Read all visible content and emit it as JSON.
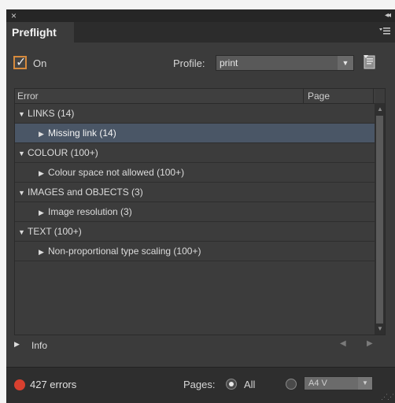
{
  "window": {
    "close_glyph": "×",
    "collapse_glyph": "◂◂"
  },
  "tab": {
    "title": "Preflight",
    "menu_icon": "panel-menu-icon"
  },
  "controls": {
    "on_checked": true,
    "on_label": "On",
    "profile_label": "Profile:",
    "profile_value": "print"
  },
  "list": {
    "columns": [
      "Error",
      "Page"
    ],
    "rows": [
      {
        "kind": "group",
        "expanded": true,
        "label": "LINKS (14)"
      },
      {
        "kind": "child",
        "expanded": false,
        "label": "Missing link (14)",
        "selected": true
      },
      {
        "kind": "group",
        "expanded": true,
        "label": "COLOUR (100+)"
      },
      {
        "kind": "child",
        "expanded": false,
        "label": "Colour space not allowed (100+)"
      },
      {
        "kind": "group",
        "expanded": true,
        "label": "IMAGES and OBJECTS (3)"
      },
      {
        "kind": "child",
        "expanded": false,
        "label": "Image resolution (3)"
      },
      {
        "kind": "group",
        "expanded": true,
        "label": "TEXT (100+)"
      },
      {
        "kind": "child",
        "expanded": false,
        "label": "Non-proportional type scaling (100+)"
      }
    ]
  },
  "info": {
    "label": "Info"
  },
  "status": {
    "error_count_text": "427 errors",
    "status_color": "#d8402f",
    "pages_label": "Pages:",
    "all_label": "All",
    "all_selected": true,
    "range_value": "A4 V"
  }
}
